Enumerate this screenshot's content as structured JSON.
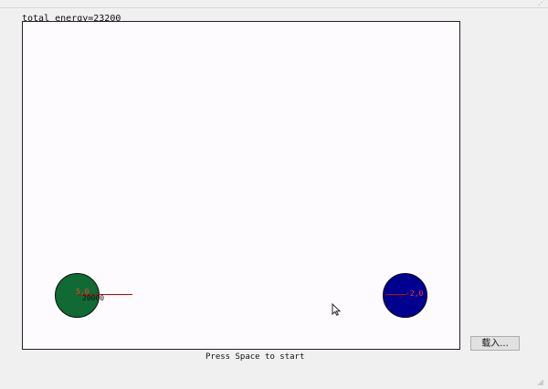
{
  "window": {
    "resize_glyph": "⋰"
  },
  "stats": {
    "energy_text": "total energy=23200"
  },
  "simulation": {
    "left_ball": {
      "speed_label": "5,0",
      "energy_label": "20000",
      "color": "#0f6a33"
    },
    "right_ball": {
      "speed_label": "-2,0",
      "color": "#00008f"
    },
    "velocity_color": "#d40000",
    "label_color": "#ff3c3c",
    "canvas_background": "#fdfbfd"
  },
  "status": {
    "start_text": "Press Space to start"
  },
  "controls": {
    "load_label": "载入..."
  },
  "icons": {
    "cursor": "mouse-cursor-icon",
    "grip": "resize-grip-icon"
  }
}
